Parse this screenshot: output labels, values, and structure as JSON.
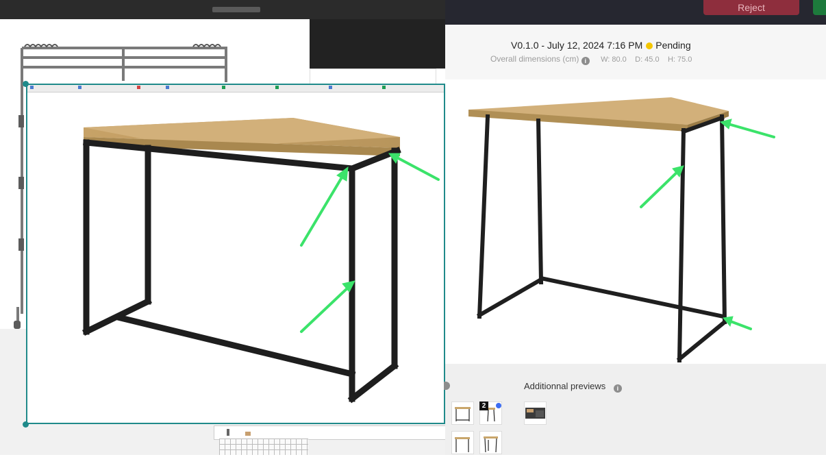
{
  "header": {
    "reject_label": "Reject",
    "version_text": "V0.1.0 - July 12, 2024 7:16 PM",
    "status_text": "Pending",
    "status_color": "#f4c600",
    "dims_label": "Overall dimensions (cm)",
    "width_value": "W: 80.0",
    "depth_value": "D: 45.0",
    "height_value": "H: 75.0"
  },
  "previews": {
    "additional_label": "Additionnal previews",
    "main_badge": "2",
    "info_icon": "i"
  },
  "overlay": {
    "border_color": "#1f8a8a",
    "arrow_color": "#3be36a",
    "tab_favicon_colors": [
      "#4a7bd0",
      "#4a7bd0",
      "#d24444",
      "#4a7bd0",
      "#1f9d55",
      "#1f9d55",
      "#4a7bd0",
      "#1f9d55",
      "#1f9d55"
    ]
  },
  "product": {
    "top_color": "#c9a66b",
    "frame_color": "#1e1e1e"
  },
  "icons": [
    "info-icon",
    "arrow-annotation",
    "table-render",
    "thumbnail-image"
  ]
}
